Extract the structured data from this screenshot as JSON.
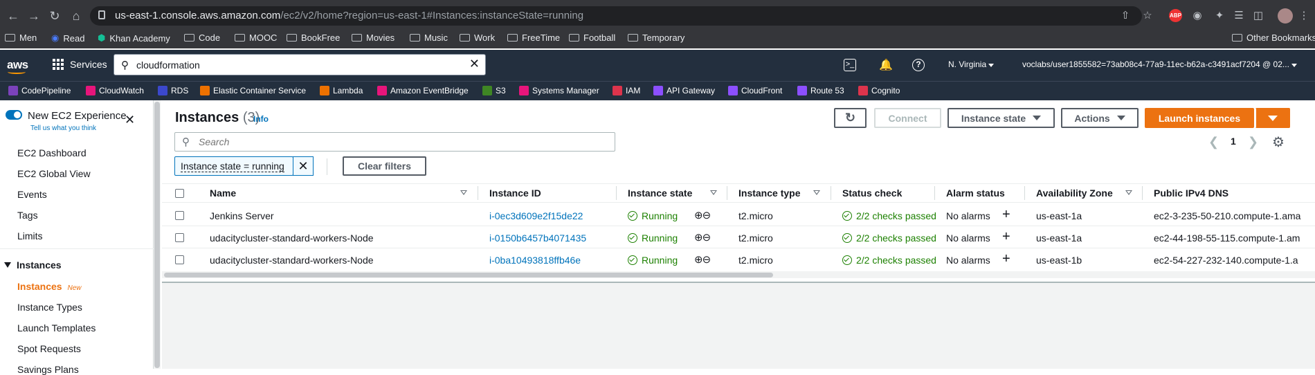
{
  "browser": {
    "url_main": "us-east-1.console.aws.amazon.com",
    "url_rest": "/ec2/v2/home?region=us-east-1#Instances:instanceState=running",
    "extension_badge": "ABP",
    "bookmarks": [
      "Men",
      "Read",
      "Khan Academy",
      "Code",
      "MOOC",
      "BookFree",
      "Movies",
      "Music",
      "Work",
      "FreeTime",
      "Football",
      "Temporary"
    ],
    "other_bookmarks": "Other Bookmarks"
  },
  "aws": {
    "logo": "aws",
    "services": "Services",
    "search_value": "cloudformation",
    "region": "N. Virginia",
    "account": "voclabs/user1855582=73ab08c4-77a9-11ec-b62a-c3491acf7204 @ 02...",
    "favorites": [
      {
        "label": "CodePipeline",
        "color": "#7b42bc"
      },
      {
        "label": "CloudWatch",
        "color": "#e7157b"
      },
      {
        "label": "RDS",
        "color": "#3b48cc"
      },
      {
        "label": "Elastic Container Service",
        "color": "#ed7100"
      },
      {
        "label": "Lambda",
        "color": "#ed7100"
      },
      {
        "label": "Amazon EventBridge",
        "color": "#e7157b"
      },
      {
        "label": "S3",
        "color": "#3f8624"
      },
      {
        "label": "Systems Manager",
        "color": "#e7157b"
      },
      {
        "label": "IAM",
        "color": "#dd344c"
      },
      {
        "label": "API Gateway",
        "color": "#8c4fff"
      },
      {
        "label": "CloudFront",
        "color": "#8c4fff"
      },
      {
        "label": "Route 53",
        "color": "#8c4fff"
      },
      {
        "label": "Cognito",
        "color": "#dd344c"
      }
    ]
  },
  "sidebar": {
    "experience_title": "New EC2 Experience",
    "experience_link": "Tell us what you think",
    "items": [
      "EC2 Dashboard",
      "EC2 Global View",
      "Events",
      "Tags",
      "Limits"
    ],
    "section": "Instances",
    "sub_items": [
      {
        "label": "Instances",
        "badge": "New"
      },
      {
        "label": "Instance Types"
      },
      {
        "label": "Launch Templates"
      },
      {
        "label": "Spot Requests"
      },
      {
        "label": "Savings Plans"
      }
    ]
  },
  "main": {
    "title": "Instances",
    "count": "(3)",
    "info": "Info",
    "connect": "Connect",
    "instance_state_btn": "Instance state",
    "actions_btn": "Actions",
    "launch_btn": "Launch instances",
    "search_placeholder": "Search",
    "filter_token": "Instance state = running",
    "clear_filters": "Clear filters",
    "page": "1"
  },
  "table": {
    "columns": [
      "Name",
      "Instance ID",
      "Instance state",
      "Instance type",
      "Status check",
      "Alarm status",
      "Availability Zone",
      "Public IPv4 DNS"
    ],
    "rows": [
      {
        "name": "Jenkins Server",
        "id": "i-0ec3d609e2f15de22",
        "state": "Running",
        "type": "t2.micro",
        "status": "2/2 checks passed",
        "alarm": "No alarms",
        "az": "us-east-1a",
        "dns": "ec2-3-235-50-210.compute-1.ama"
      },
      {
        "name": "udacitycluster-standard-workers-Node",
        "id": "i-0150b6457b4071435",
        "state": "Running",
        "type": "t2.micro",
        "status": "2/2 checks passed",
        "alarm": "No alarms",
        "az": "us-east-1a",
        "dns": "ec2-44-198-55-115.compute-1.am"
      },
      {
        "name": "udacitycluster-standard-workers-Node",
        "id": "i-0ba10493818ffb46e",
        "state": "Running",
        "type": "t2.micro",
        "status": "2/2 checks passed",
        "alarm": "No alarms",
        "az": "us-east-1b",
        "dns": "ec2-54-227-232-140.compute-1.a"
      }
    ]
  },
  "colors": {
    "aws_nav": "#232f3e",
    "primary": "#ec7211",
    "link": "#0073bb",
    "success": "#1d8102"
  }
}
